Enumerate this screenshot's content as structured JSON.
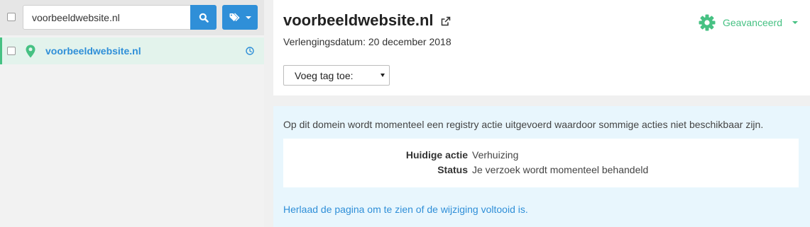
{
  "sidebar": {
    "search": {
      "value": "voorbeeldwebsite.nl"
    },
    "items": [
      {
        "label": "voorbeeldwebsite.nl"
      }
    ]
  },
  "header": {
    "title": "voorbeeldwebsite.nl",
    "renewal_text": "Verlengingsdatum: 20 december 2018",
    "advanced_label": "Geavanceerd",
    "tag_select": {
      "selected": "Voeg tag toe:"
    }
  },
  "notice": {
    "text": "Op dit domein wordt momenteel een registry actie uitgevoerd waardoor sommige acties niet beschikbaar zijn.",
    "details": [
      {
        "label": "Huidige actie",
        "value": "Verhuizing"
      },
      {
        "label": "Status",
        "value": "Je verzoek wordt momenteel behandeld"
      }
    ],
    "reload_link": "Herlaad de pagina om te zien of de wijziging voltooid is."
  },
  "colors": {
    "accent_blue": "#2f8fd8",
    "accent_green": "#46c183",
    "selected_row_bg": "#e3f3ec",
    "notice_bg": "#e8f6fd"
  },
  "icons": [
    "search-icon",
    "tag-icon",
    "map-pin-icon",
    "clock-icon",
    "external-link-icon",
    "gear-icon",
    "chevron-down-icon"
  ]
}
